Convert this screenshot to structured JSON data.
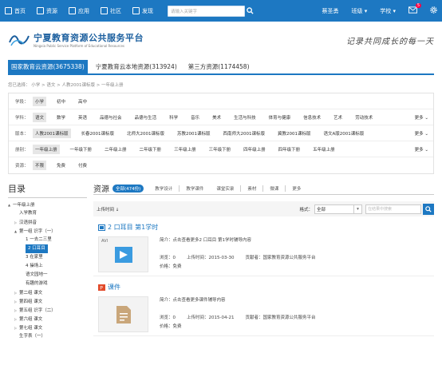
{
  "topbar": {
    "nav": [
      {
        "label": "首页",
        "icon": "home-icon"
      },
      {
        "label": "资源",
        "icon": "folder-icon"
      },
      {
        "label": "应用",
        "icon": "grid-icon"
      },
      {
        "label": "社区",
        "icon": "chat-icon"
      },
      {
        "label": "发现",
        "icon": "compass-icon"
      }
    ],
    "search_placeholder": "请输入关键字",
    "user": "蔡圣勇",
    "class": "班级",
    "school": "学校",
    "msg_count": "5"
  },
  "header": {
    "title": "宁夏教育资源公共服务平台",
    "subtitle": "Ningxia Public Service Platform of Educational Resources",
    "slogan": "记录共同成长的每一天"
  },
  "tabs": [
    "国家教育云资源(3675338)",
    "宁夏教育云本地资源(313924)",
    "第三方资源(1174458)"
  ],
  "breadcrumb": "您已选择： 小学 > 语文 > 人教2001课标版 > 一年级上册",
  "filters": [
    {
      "label": "学段：",
      "options": [
        "小学",
        "初中",
        "高中"
      ],
      "selected": 0,
      "more": ""
    },
    {
      "label": "学科：",
      "options": [
        "语文",
        "数学",
        "英语",
        "品德与社会",
        "品德与生活",
        "科学",
        "音乐",
        "美术",
        "生活与科技",
        "体育与健康",
        "信息技术",
        "艺术",
        "劳动技术"
      ],
      "selected": 0,
      "more": "更多"
    },
    {
      "label": "版本：",
      "options": [
        "人教2001课标版",
        "长春2001课标版",
        "北师大2001课标版",
        "苏教2001课标版",
        "西南师大2001课标版",
        "冀教2001课标版",
        "语文A版2001课标版"
      ],
      "selected": 0,
      "more": "更多"
    },
    {
      "label": "册别：",
      "options": [
        "一年级上册",
        "一年级下册",
        "二年级上册",
        "二年级下册",
        "三年级上册",
        "三年级下册",
        "四年级上册",
        "四年级下册",
        "五年级上册"
      ],
      "selected": 0,
      "more": "更多"
    },
    {
      "label": "资源：",
      "options": [
        "不限",
        "免费",
        "付费"
      ],
      "selected": 0,
      "more": ""
    }
  ],
  "tree": {
    "heading": "目录",
    "nodes": [
      {
        "label": "一年级上册",
        "indent": 0,
        "toggle": "▲"
      },
      {
        "label": "入学教育",
        "indent": 1,
        "toggle": ""
      },
      {
        "label": "汉语拼音",
        "indent": 1,
        "toggle": "▷"
      },
      {
        "label": "第一组 识字（一）",
        "indent": 1,
        "toggle": "▲"
      },
      {
        "label": "1 一去二三里",
        "indent": 2,
        "toggle": ""
      },
      {
        "label": "2 口耳目",
        "indent": 2,
        "toggle": "",
        "active": true
      },
      {
        "label": "3 在家里",
        "indent": 2,
        "toggle": ""
      },
      {
        "label": "4 操场上",
        "indent": 2,
        "toggle": ""
      },
      {
        "label": "语文园地一",
        "indent": 2,
        "toggle": ""
      },
      {
        "label": "有趣的游戏",
        "indent": 2,
        "toggle": ""
      },
      {
        "label": "第二组 课文",
        "indent": 1,
        "toggle": "▷"
      },
      {
        "label": "第四组 课文",
        "indent": 1,
        "toggle": "▷"
      },
      {
        "label": "第五组 识字（二）",
        "indent": 1,
        "toggle": "▷"
      },
      {
        "label": "第六组 课文",
        "indent": 1,
        "toggle": "▷"
      },
      {
        "label": "第七组 课文",
        "indent": 1,
        "toggle": "▷"
      },
      {
        "label": "生字表（一）",
        "indent": 1,
        "toggle": ""
      }
    ]
  },
  "content": {
    "title": "资源",
    "all_tab": "全部(474份)",
    "cats": [
      "教学设计",
      "教学课件",
      "课堂实录",
      "素材",
      "微课",
      "更多"
    ],
    "sort_label": "上传时间",
    "format_label": "格式：",
    "format_value": "全部",
    "search_placeholder": "在结果中搜索",
    "items": [
      {
        "title": "2 口耳目 第1学时",
        "icon": "avi-icon",
        "thumb_label": "AVI",
        "desc": "简介：点击查看更多2 口耳目 第1学时辅导内容",
        "views": "浏览：0",
        "date": "上传时间：2015-03-30",
        "author": "贡献者：国家教育资源公共服务平台",
        "price": "价格：免费"
      },
      {
        "title": "课件",
        "icon": "ppt-icon",
        "thumb_label": "",
        "desc": "简介：点击查看更多课件辅导内容",
        "views": "浏览：0",
        "date": "上传时间：2015-04-21",
        "author": "贡献者：国家教育资源公共服务平台",
        "price": "价格：免费"
      }
    ]
  }
}
